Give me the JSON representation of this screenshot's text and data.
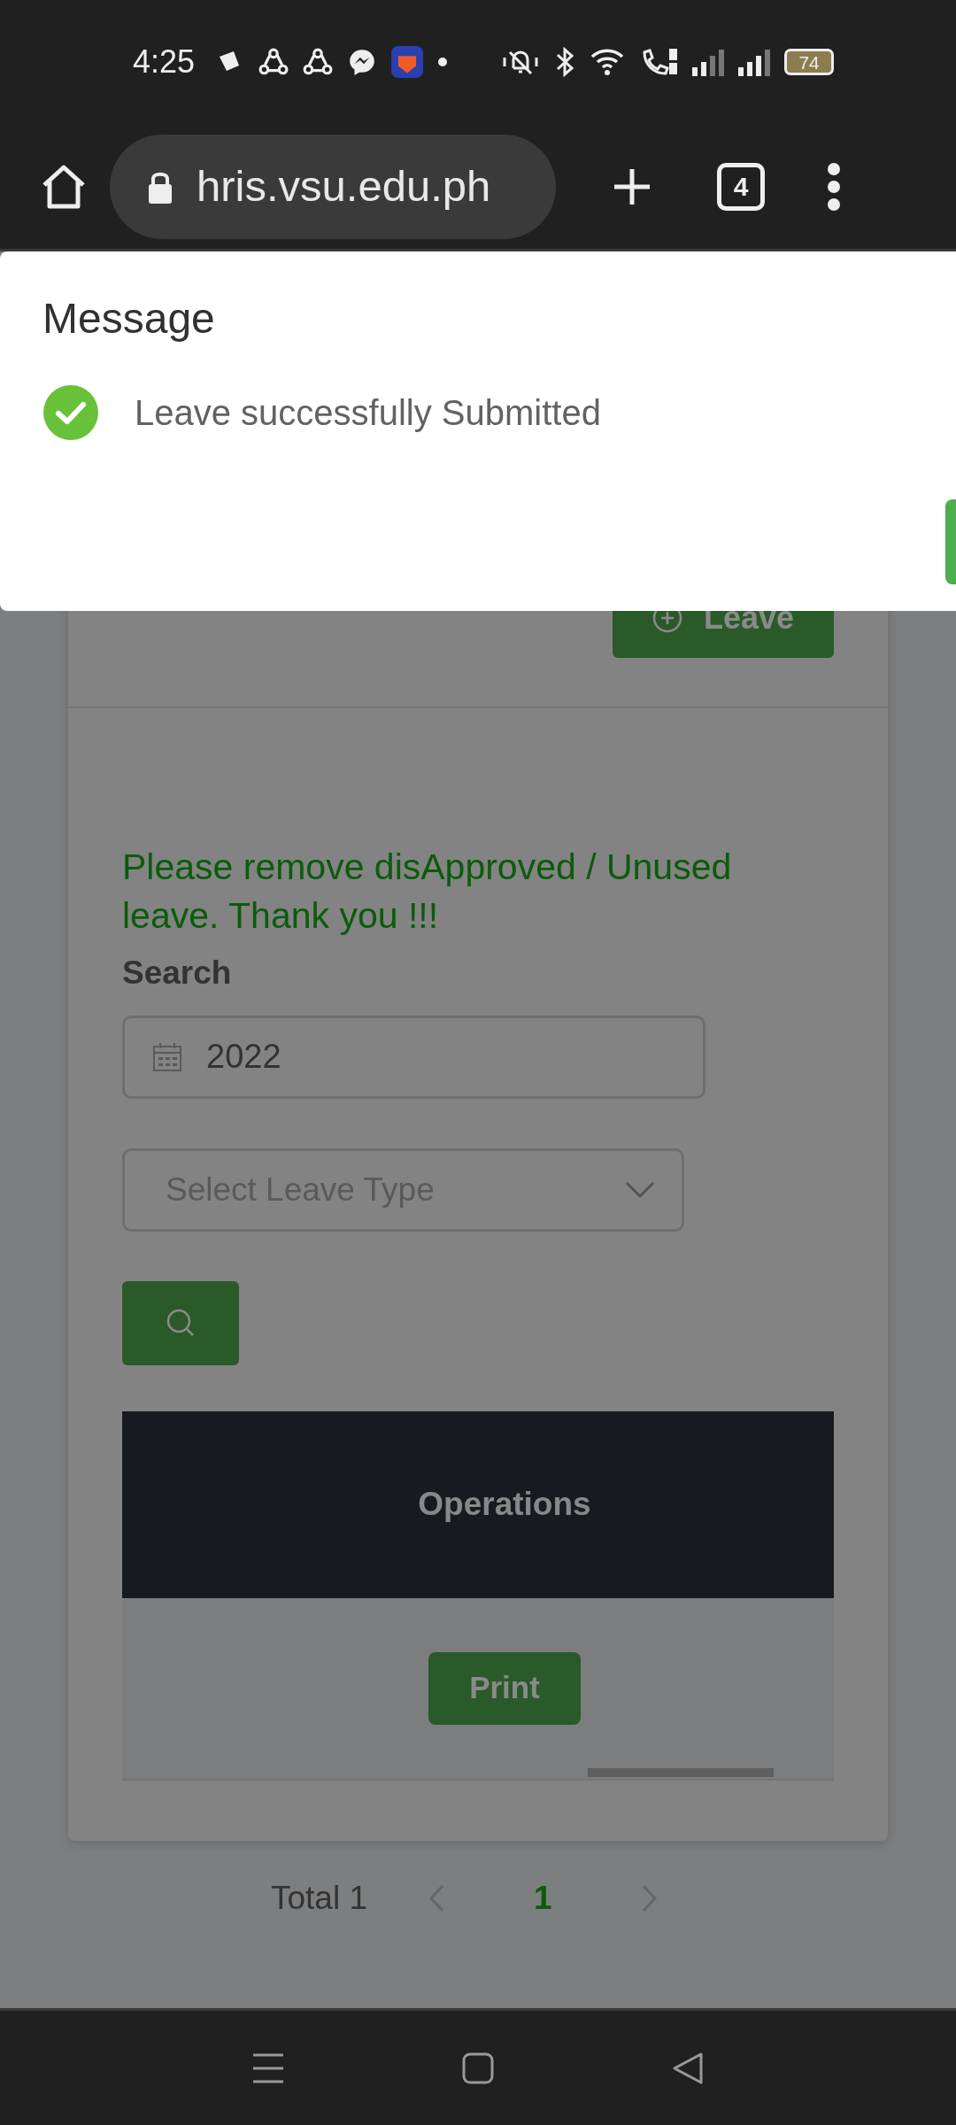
{
  "status_bar": {
    "time": "4:25",
    "battery": "74"
  },
  "browser": {
    "url": "hris.vsu.edu.ph",
    "tab_count": "4"
  },
  "dialog": {
    "title": "Message",
    "message": "Leave successfully Submitted"
  },
  "page": {
    "add_button": "Leave",
    "notice": "Please remove disApproved / Unused leave. Thank you !!!",
    "search_label": "Search",
    "year_field": {
      "value": "2022"
    },
    "leave_type": {
      "placeholder": "Select Leave Type"
    },
    "table": {
      "columns": [
        "Operations"
      ],
      "rows": [
        {
          "action": "Print"
        }
      ]
    },
    "pagination": {
      "total": "Total 1",
      "pages": [
        {
          "label": "1",
          "selected": true
        }
      ]
    }
  }
}
